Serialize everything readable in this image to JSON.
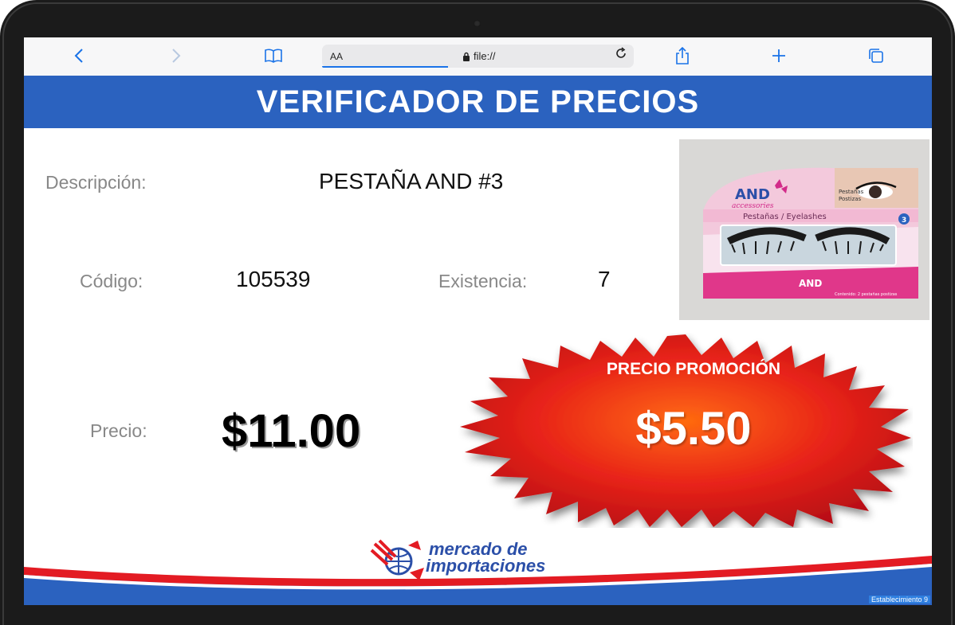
{
  "browser": {
    "aa_label": "AA",
    "url": "file://",
    "icons": [
      "back-icon",
      "forward-icon",
      "bookmarks-icon",
      "lock-icon",
      "reload-icon",
      "share-icon",
      "new-tab-icon",
      "tabs-icon"
    ]
  },
  "page": {
    "title": "VERIFICADOR DE PRECIOS",
    "description_label": "Descripción:",
    "description_value": "PESTAÑA AND #3",
    "code_label": "Código:",
    "code_value": "105539",
    "stock_label": "Existencia:",
    "stock_value": "7",
    "price_label": "Precio:",
    "price_value": "$11.00",
    "promo_label": "PRECIO PROMOCIÓN",
    "promo_price": "$5.50",
    "logo_line1": "mercado de",
    "logo_line2": "importaciones",
    "store": "Establecimiento 9"
  },
  "product_image": {
    "brand": "AND",
    "brand_sub": "accessories",
    "line1": "Pestañas",
    "line2": "Postizas",
    "strip": "Pestañas / Eyelashes",
    "number": "3",
    "content": "Contenido: 2 pestañas postizas"
  },
  "colors": {
    "header": "#2b62bf",
    "promo_burst": "#e8231a",
    "logo_blue": "#2b4fa8",
    "footer_red": "#e31b23"
  }
}
